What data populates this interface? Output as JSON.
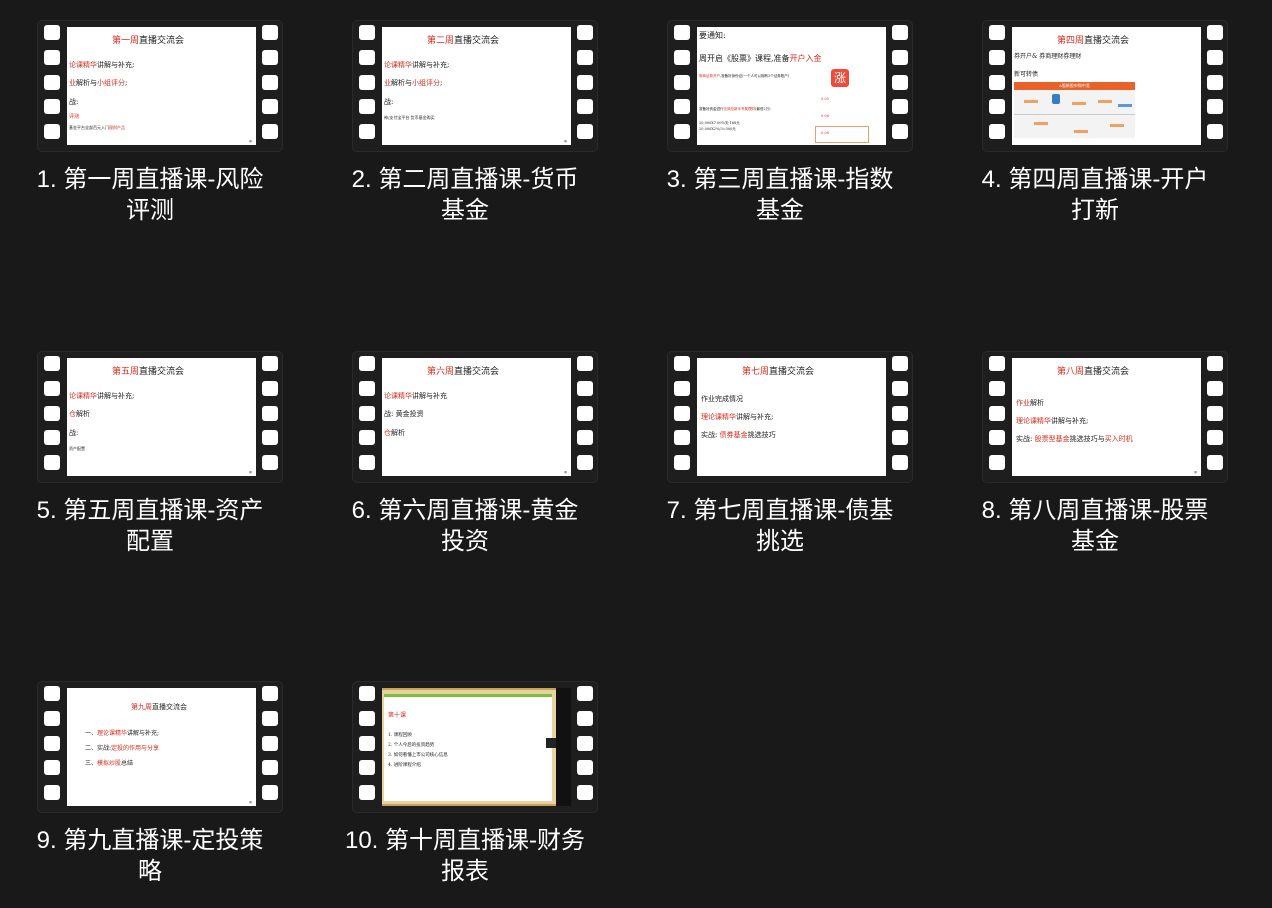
{
  "items": [
    {
      "caption": "1. 第一周直播课-风险评测",
      "slide": {
        "title_red": "第一周",
        "title_rest": "直播交流会",
        "l1_red": "论课精华",
        "l1_rest": "讲解与补充;",
        "l2_red": "业",
        "l2_mid": "解析与",
        "l2_red2": "小组评分",
        "l2_end": ";",
        "l3": "战:",
        "l4_red": "评测",
        "l5": "基金平台全部百元入门",
        "l5_red": "理财产品"
      }
    },
    {
      "caption": "2. 第二周直播课-货币基金",
      "slide": {
        "title_red": "第二周",
        "title_rest": "直播交流会",
        "l1_red": "论课精华",
        "l1_rest": "讲解与补充;",
        "l2_red": "业",
        "l2_mid": "解析与",
        "l2_red2": "小组评分",
        "l2_end": ";",
        "l3": "战:",
        "l4": "神/支付宝平台 货币基金购买"
      }
    },
    {
      "caption": "3. 第三周直播课-指数基金",
      "slide": {
        "l1": "要通知:",
        "l2": "周开启《股票》课程,准备",
        "l2_red": "开户入金",
        "l3_red": "券商证券开户",
        "l3": ",准备好身份证(一个人可以拥有3个证券账户)",
        "l4": "准备好资金进行",
        "l4_red": "无风险新手专属理财",
        "l4_end": "(最低2万)",
        "l5": "20,000X7.00%天-168元",
        "l6": "20,000X2%/3=300元",
        "r1": "0.05",
        "r2": "0.06",
        "r3": "0.08",
        "logo": "涨"
      }
    },
    {
      "caption": "4. 第四周直播课-开户打新",
      "slide": {
        "title_red": "第四周",
        "title_rest": "直播交流会",
        "l1": "券开户& 券商理财券理财",
        "l2": "新可转债",
        "banner": "A股新股申购中签"
      }
    },
    {
      "caption": "5. 第五周直播课-资产配置",
      "slide": {
        "title_red": "第五周",
        "title_rest": "直播交流会",
        "l1_red": "论课精华",
        "l1_rest": "讲解与补充;",
        "l2_red": "仓",
        "l2_rest": "解析",
        "l3": "战:",
        "l4": "资产配置"
      }
    },
    {
      "caption": "6. 第六周直播课-黄金投资",
      "slide": {
        "title_red": "第六周",
        "title_rest": "直播交流会",
        "l1_red": "论课精华",
        "l1_rest": "讲解与补充",
        "l2": "战: 黄金投资",
        "l3_red": "仓",
        "l3_rest": "解析"
      }
    },
    {
      "caption": "7. 第七周直播课-债基挑选",
      "slide": {
        "title_red": "第七周",
        "title_rest": "直播交流会",
        "l1": "作业完成情况",
        "l2_red": "理论课精华",
        "l2_rest": "讲解与补充;",
        "l3": "实战:",
        "l3_red": "债券基金",
        "l3_rest": "挑选技巧"
      }
    },
    {
      "caption": "8. 第八周直播课-股票基金",
      "slide": {
        "title_red": "第八周",
        "title_rest": "直播交流会",
        "l1_red": "作业",
        "l1_rest": "解析",
        "l2_red": "理论课精华",
        "l2_rest": "讲解与补充;",
        "l3": "实战:",
        "l3_red": "股票型基金",
        "l3_mid": "挑选技巧与",
        "l3_red2": "买入时机"
      }
    },
    {
      "caption": "9. 第九直播课-定投策略",
      "slide": {
        "title_red": "第九周",
        "title_rest": "直播交流会",
        "l1": "一、",
        "l1_red": "理论课精华",
        "l1_rest": "讲解与补充;",
        "l2": "二、实战:",
        "l2_red": "定投的作用与分享",
        "l3": "三、",
        "l3_red": "模拟炒股",
        "l3_rest": "总结"
      }
    },
    {
      "caption": "10. 第十周直播课-财务报表",
      "slide": {
        "title": "第十课",
        "l1": "1.   课程回顾",
        "l2": "2.   个人今后的投资趋势",
        "l3": "3.   如何看懂上市公司核心信息",
        "l4": "4.   进阶课程介绍"
      }
    }
  ]
}
